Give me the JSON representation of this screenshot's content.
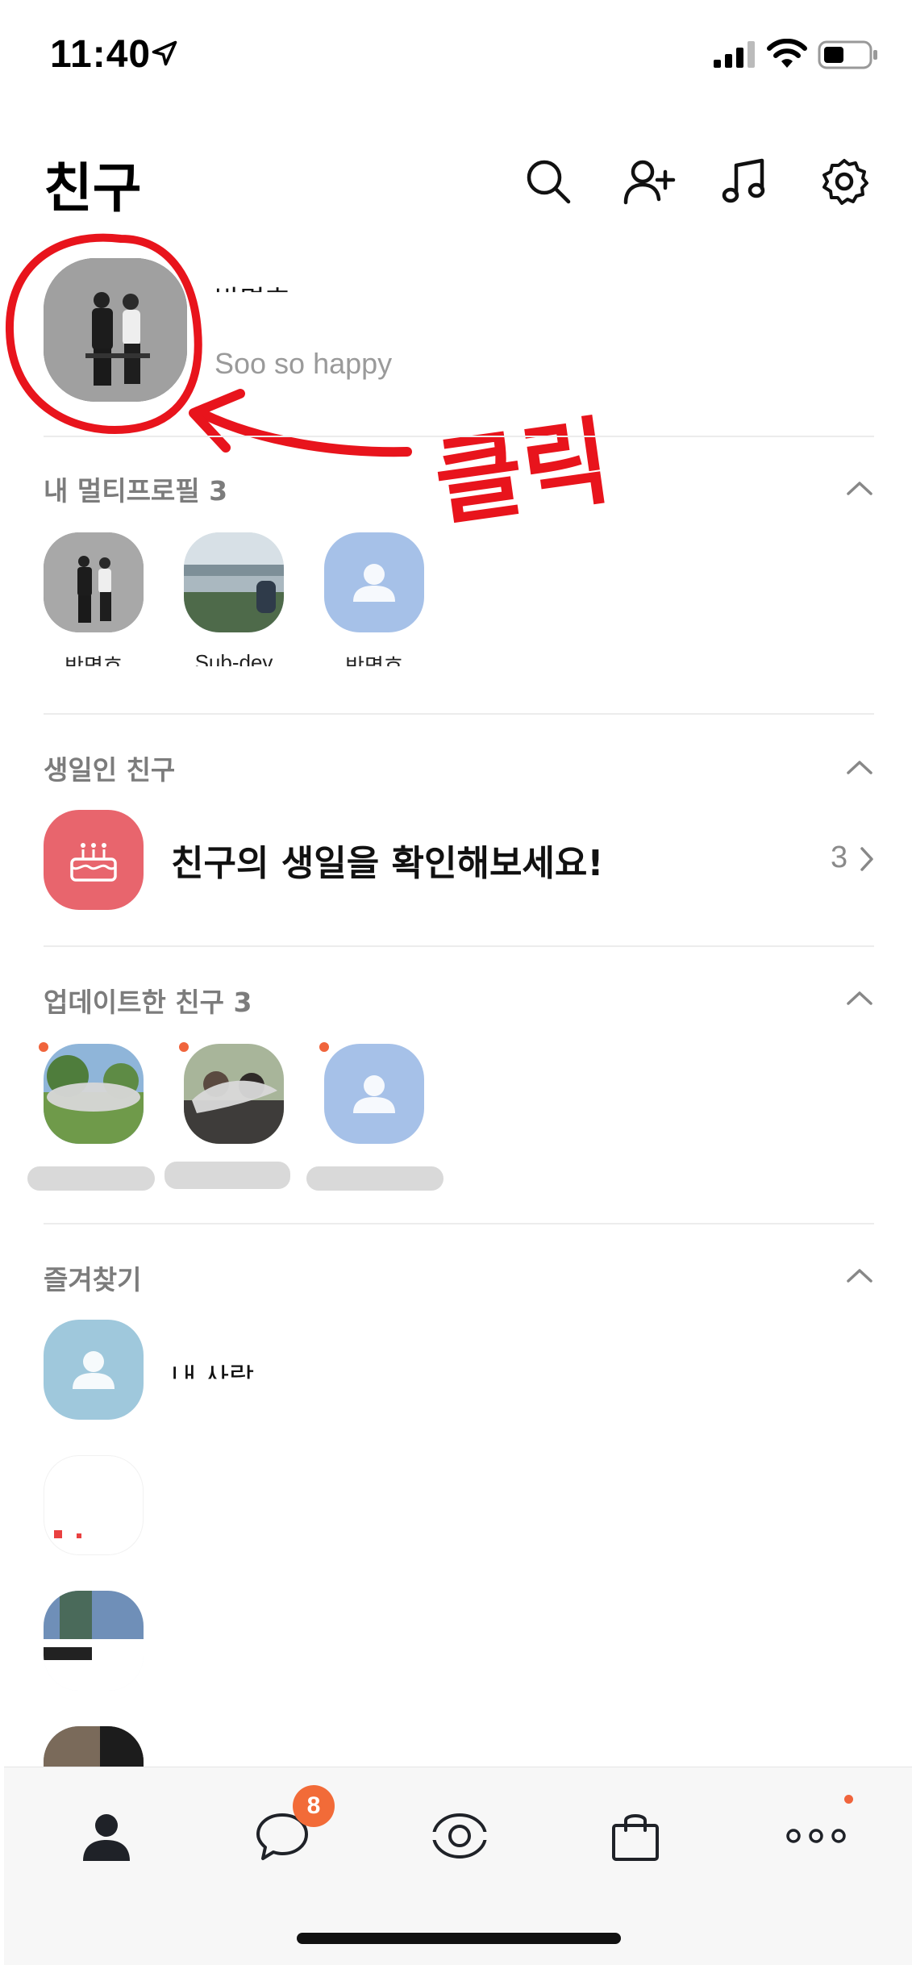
{
  "status_bar": {
    "time": "11:40"
  },
  "header": {
    "title": "친구",
    "icons": [
      "search-icon",
      "add-friend-icon",
      "music-icon",
      "settings-icon"
    ]
  },
  "profile": {
    "name": "박명호",
    "status_message": "Soo so happy"
  },
  "annotation": {
    "text": "클릭",
    "color": "#e8141c"
  },
  "multi_profile": {
    "title": "내 멀티프로필 3",
    "items": [
      {
        "label": "박명호"
      },
      {
        "label": "Sub-dev"
      },
      {
        "label": "박명호"
      }
    ]
  },
  "birthday": {
    "title": "생일인 친구",
    "message": "친구의 생일을 확인해보세요!",
    "count": "3"
  },
  "updated_friends": {
    "title": "업데이트한 친구 3",
    "items": [
      {
        "label": ""
      },
      {
        "label": ""
      },
      {
        "label": ""
      }
    ]
  },
  "favorites": {
    "title": "즐겨찾기",
    "items": [
      {
        "name": "내 사랑"
      },
      {
        "name": ""
      },
      {
        "name": ""
      },
      {
        "name": ""
      }
    ]
  },
  "tab_bar": {
    "tabs": [
      "friends-tab",
      "chats-tab",
      "view-tab",
      "shopping-tab",
      "more-tab"
    ],
    "chat_badge": "8"
  },
  "colors": {
    "accent": "#f26b38",
    "birthday": "#e8656d",
    "default_avatar": "#a6c1e8",
    "annotation": "#e8141c"
  }
}
